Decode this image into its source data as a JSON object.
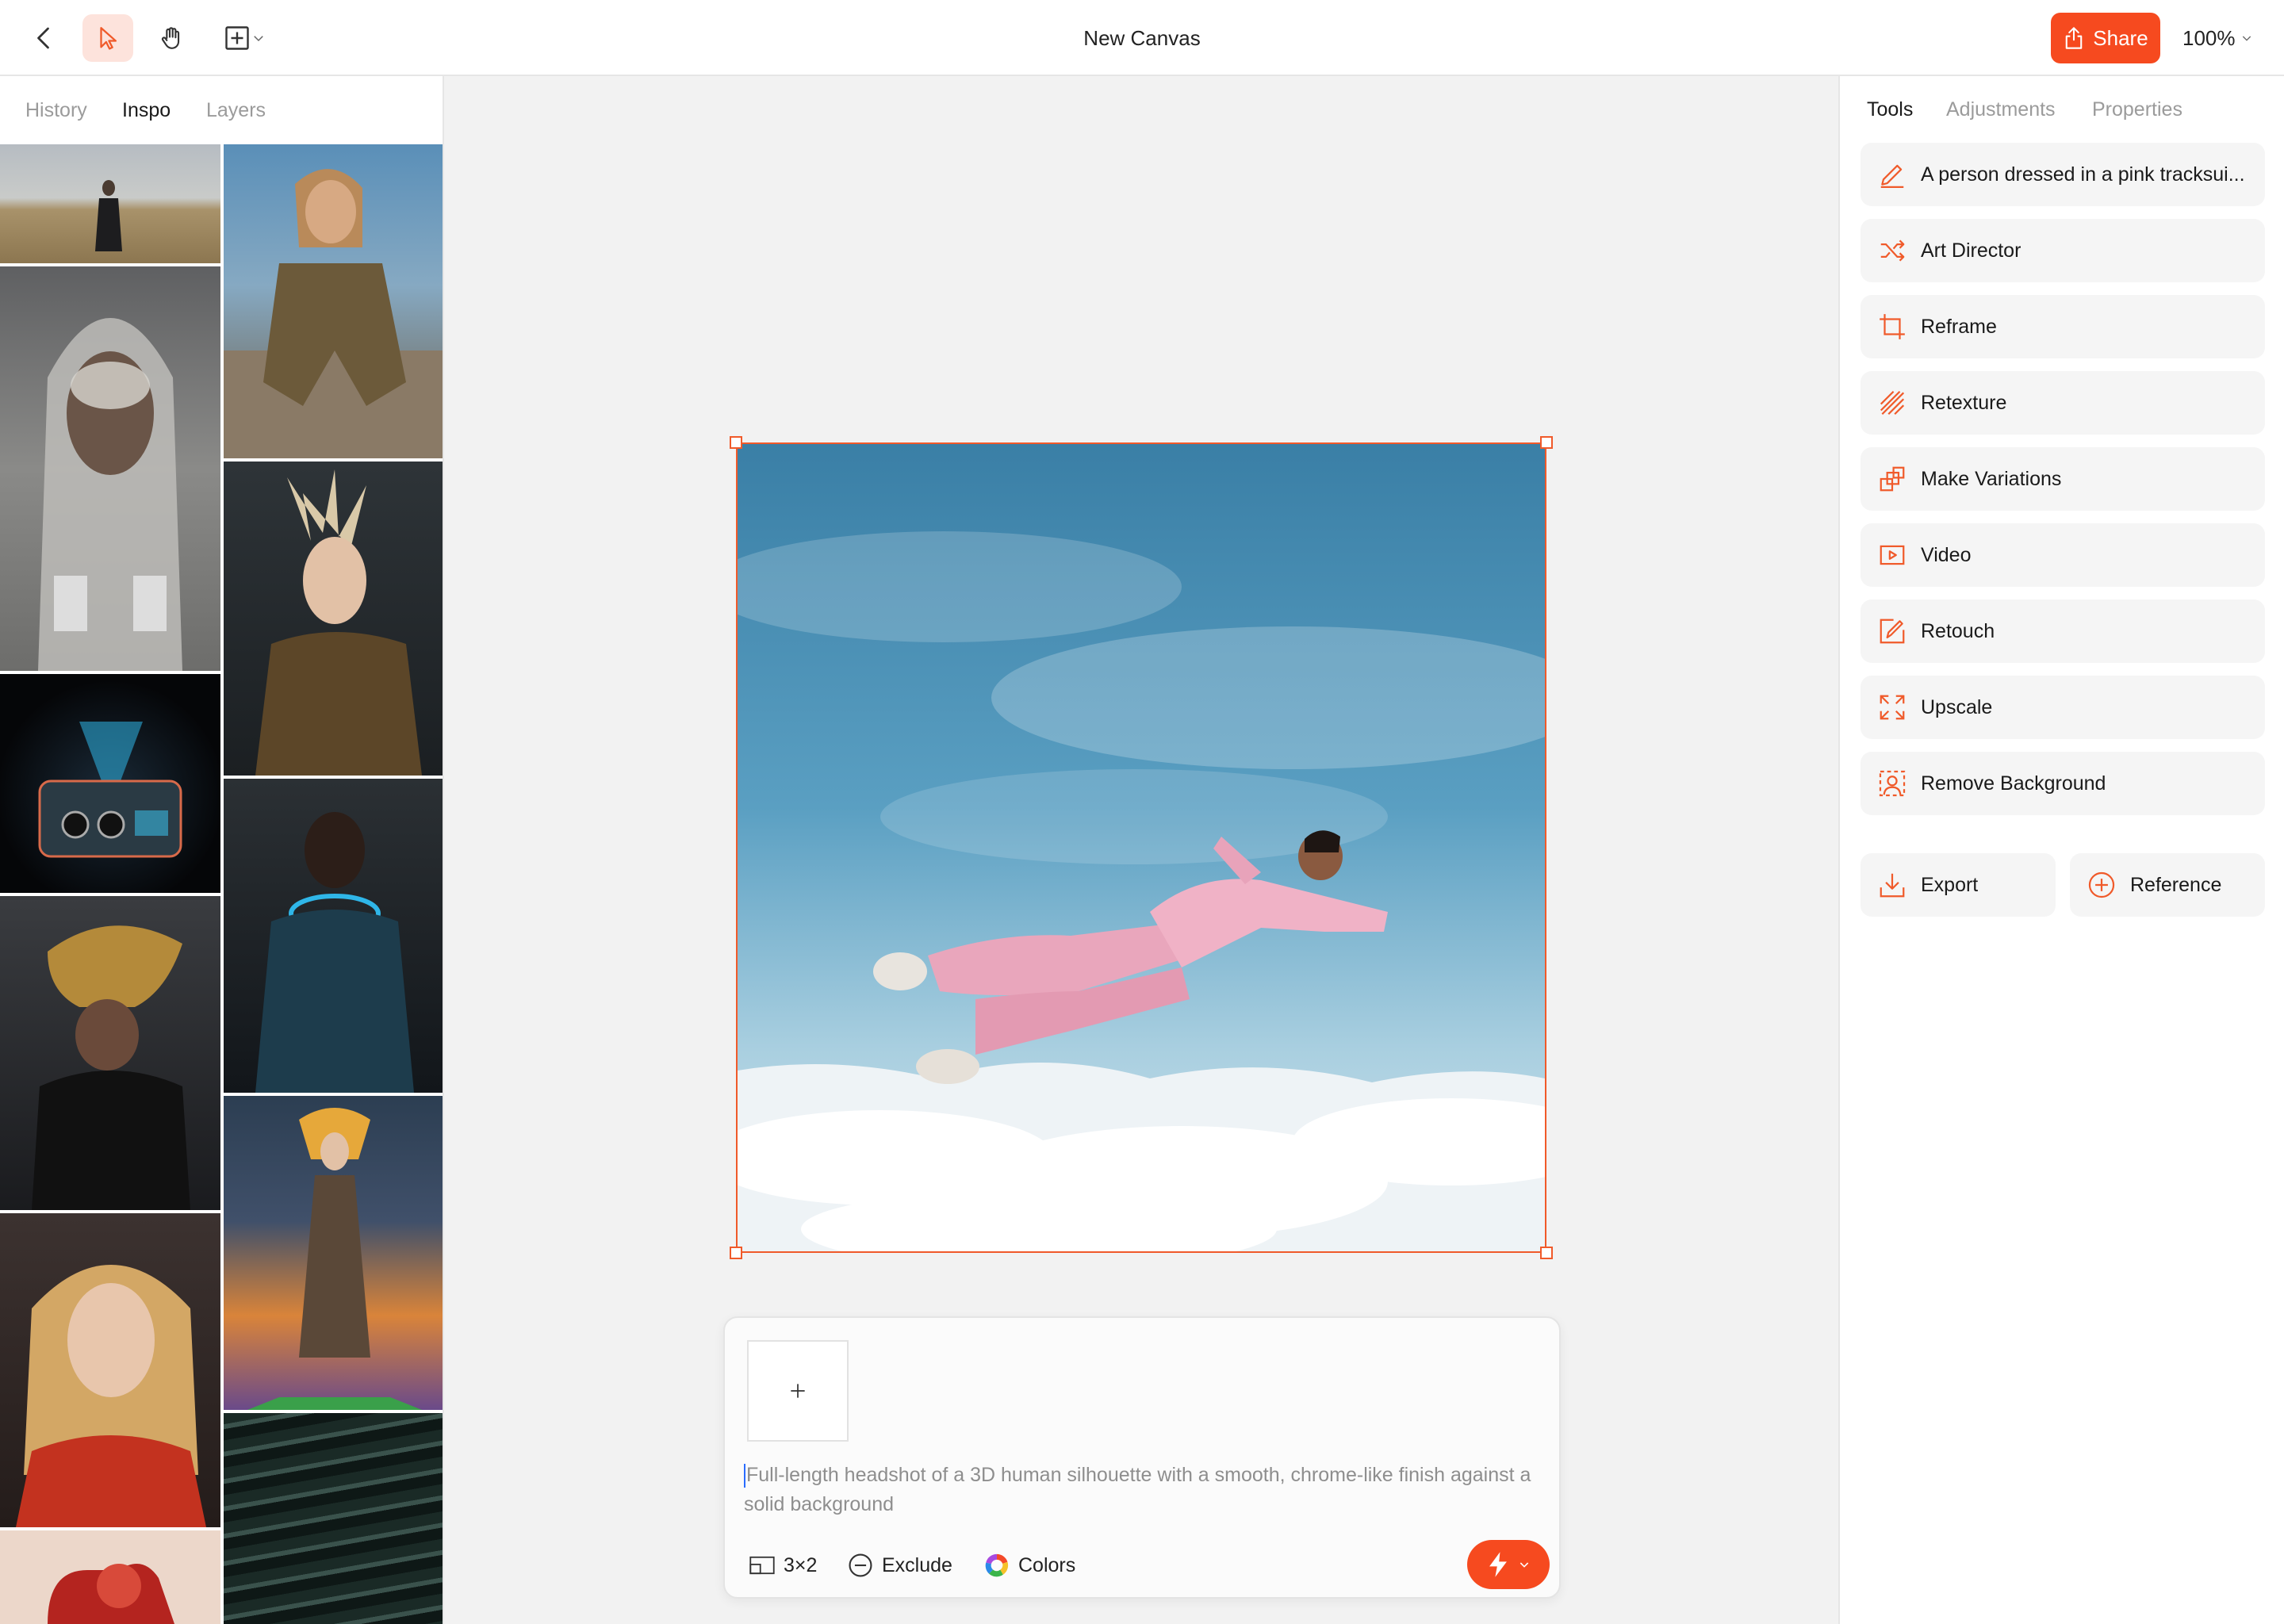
{
  "header": {
    "title": "New Canvas",
    "share_label": "Share",
    "zoom": "100%"
  },
  "left_panel": {
    "tabs": [
      {
        "label": "History",
        "active": false
      },
      {
        "label": "Inspo",
        "active": true
      },
      {
        "label": "Layers",
        "active": false
      }
    ]
  },
  "prompt": {
    "text": "Full-length headshot of a 3D human silhouette with a smooth, chrome-like finish against a solid background",
    "aspect_label": "3×2",
    "exclude_label": "Exclude",
    "colors_label": "Colors"
  },
  "right_panel": {
    "tabs": [
      {
        "label": "Tools",
        "active": true
      },
      {
        "label": "Adjustments",
        "active": false
      },
      {
        "label": "Properties",
        "active": false
      }
    ],
    "tools": [
      {
        "label": "A person dressed in a pink tracksui...",
        "icon": "pencil-icon"
      },
      {
        "label": "Art Director",
        "icon": "shuffle-icon"
      },
      {
        "label": "Reframe",
        "icon": "crop-icon"
      },
      {
        "label": "Retexture",
        "icon": "texture-icon"
      },
      {
        "label": "Make Variations",
        "icon": "variations-icon"
      },
      {
        "label": "Video",
        "icon": "video-icon"
      },
      {
        "label": "Retouch",
        "icon": "retouch-icon"
      },
      {
        "label": "Upscale",
        "icon": "upscale-icon"
      },
      {
        "label": "Remove Background",
        "icon": "remove-background-icon"
      }
    ],
    "export_label": "Export",
    "reference_label": "Reference"
  },
  "colors": {
    "accent": "#f64a1f",
    "selection": "#f05a2a",
    "accent_soft": "#fde3dc"
  }
}
